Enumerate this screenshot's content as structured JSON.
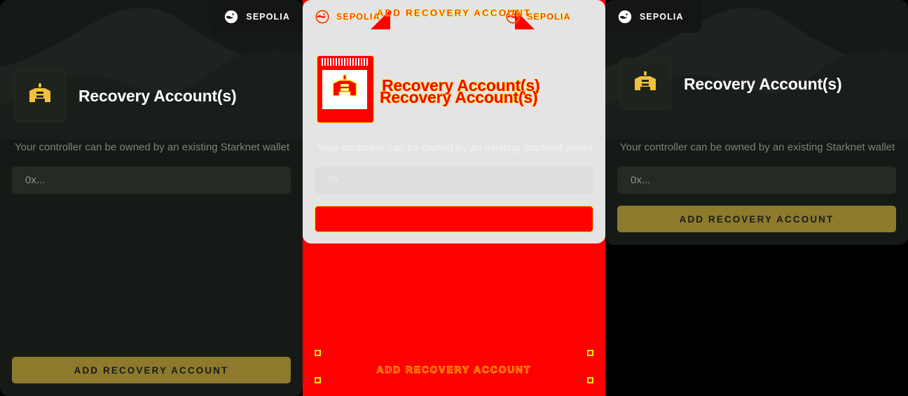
{
  "view": {
    "kind": "visual-diff",
    "colors": {
      "panel_bg": "#161a17",
      "tab_bg": "#131613",
      "accent_gold": "#8d7a2c",
      "logo_gold": "#f0c13c",
      "input_bg": "#242a24",
      "muted_text": "#7c8279",
      "diff_add": "#ff0000",
      "diff_outline": "#ffee00",
      "diff_card_bg": "#e4e4e4",
      "canvas_bg": "#000000"
    }
  },
  "baseline": {
    "network": {
      "label": "SEPOLIA",
      "icon": "sepolia-network-icon"
    },
    "logo_icon": "cartridge-controller-icon",
    "title": "Recovery Account(s)",
    "description": "Your controller can be owned by an existing Starknet wallet",
    "address_input": {
      "value": "",
      "placeholder": "0x..."
    },
    "cta_label": "ADD RECOVERY ACCOUNT"
  },
  "diff": {
    "network_left": {
      "label": "SEPOLIA",
      "icon": "sepolia-network-icon"
    },
    "network_right": {
      "label": "SEPOLIA",
      "icon": "sepolia-network-icon"
    },
    "logo_icon": "cartridge-controller-icon",
    "title_a": "Recovery Account(s)",
    "title_b": "Recovery Account(s)",
    "description": "Your controller can be owned by an existing Starknet wallet",
    "address_placeholder": "0x...",
    "cta_label": "ADD RECOVERY ACCOUNT",
    "overflow_cta_label": "ADD RECOVERY ACCOUNT"
  },
  "newshot": {
    "network": {
      "label": "SEPOLIA",
      "icon": "sepolia-network-icon"
    },
    "logo_icon": "cartridge-controller-icon",
    "title": "Recovery Account(s)",
    "description": "Your controller can be owned by an existing Starknet wallet",
    "address_input": {
      "value": "",
      "placeholder": "0x..."
    },
    "cta_label": "ADD RECOVERY ACCOUNT"
  }
}
